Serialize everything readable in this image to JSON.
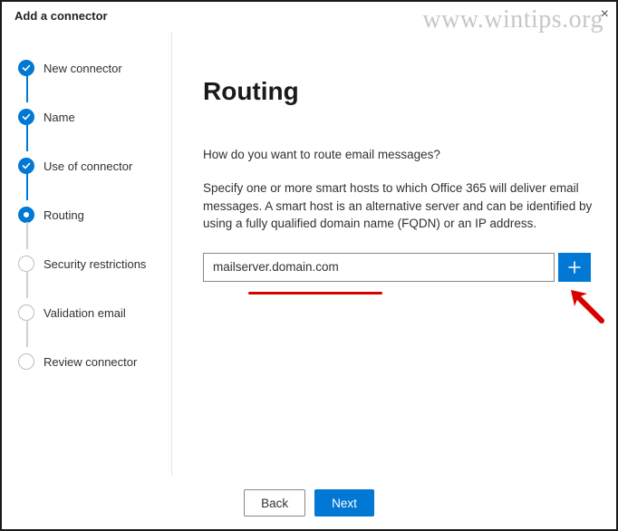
{
  "watermark": "www.wintips.org",
  "header": {
    "title": "Add a connector"
  },
  "sidebar": {
    "steps": [
      {
        "label": "New connector"
      },
      {
        "label": "Name"
      },
      {
        "label": "Use of connector"
      },
      {
        "label": "Routing"
      },
      {
        "label": "Security restrictions"
      },
      {
        "label": "Validation email"
      },
      {
        "label": "Review connector"
      }
    ]
  },
  "main": {
    "heading": "Routing",
    "question": "How do you want to route email messages?",
    "description": "Specify one or more smart hosts to which Office 365 will deliver email messages. A smart host is an alternative server and can be identified by using a fully qualified domain name (FQDN) or an IP address.",
    "host_input_value": "mailserver.domain.com"
  },
  "footer": {
    "back_label": "Back",
    "next_label": "Next"
  }
}
